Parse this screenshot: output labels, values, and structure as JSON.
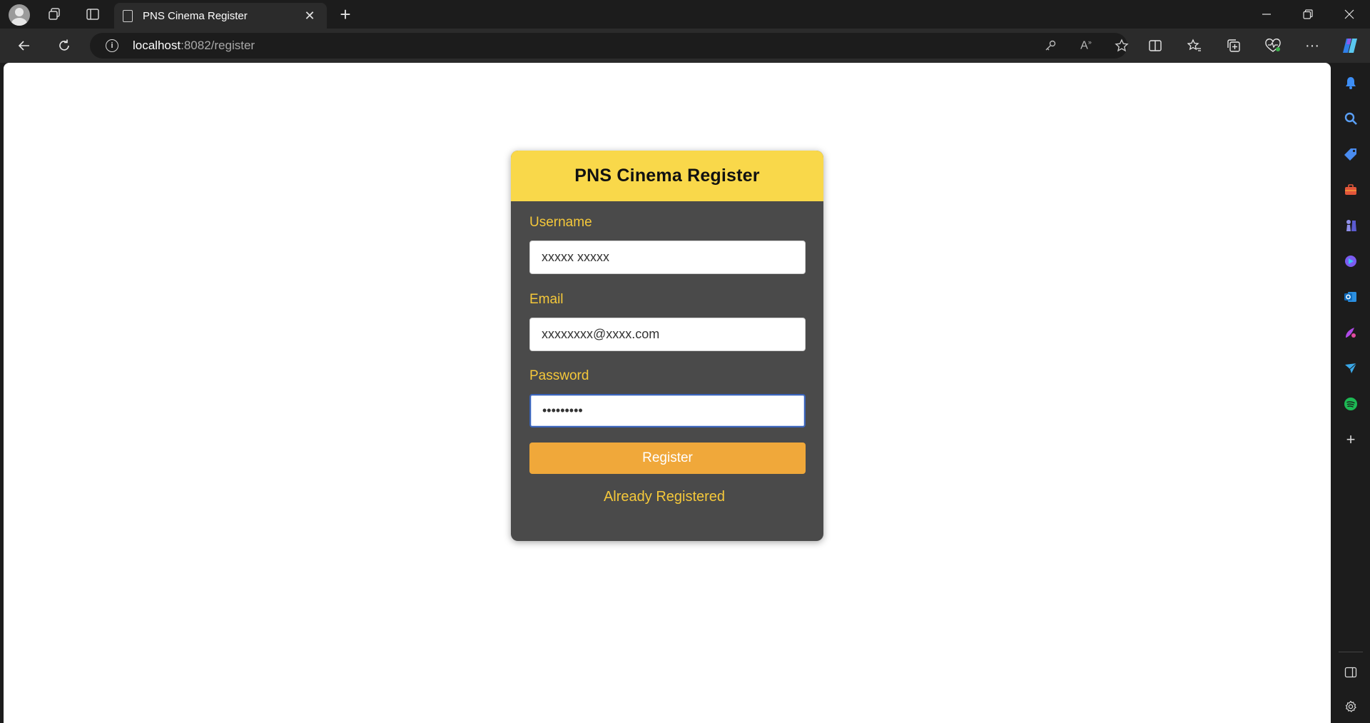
{
  "browser": {
    "tab_title": "PNS Cinema Register",
    "url_host": "localhost",
    "url_path": ":8082/register"
  },
  "form": {
    "title": "PNS Cinema Register",
    "username_label": "Username",
    "username_value": "xxxxx xxxxx",
    "email_label": "Email",
    "email_value": "xxxxxxxx@xxxx.com",
    "password_label": "Password",
    "password_value": "•••••••••",
    "register_label": "Register",
    "login_link": "Already Registered"
  },
  "colors": {
    "header_yellow": "#f9d84a",
    "card_bg": "#4a4a4a",
    "label_gold": "#f5c83a",
    "button_orange": "#f0a83a"
  }
}
